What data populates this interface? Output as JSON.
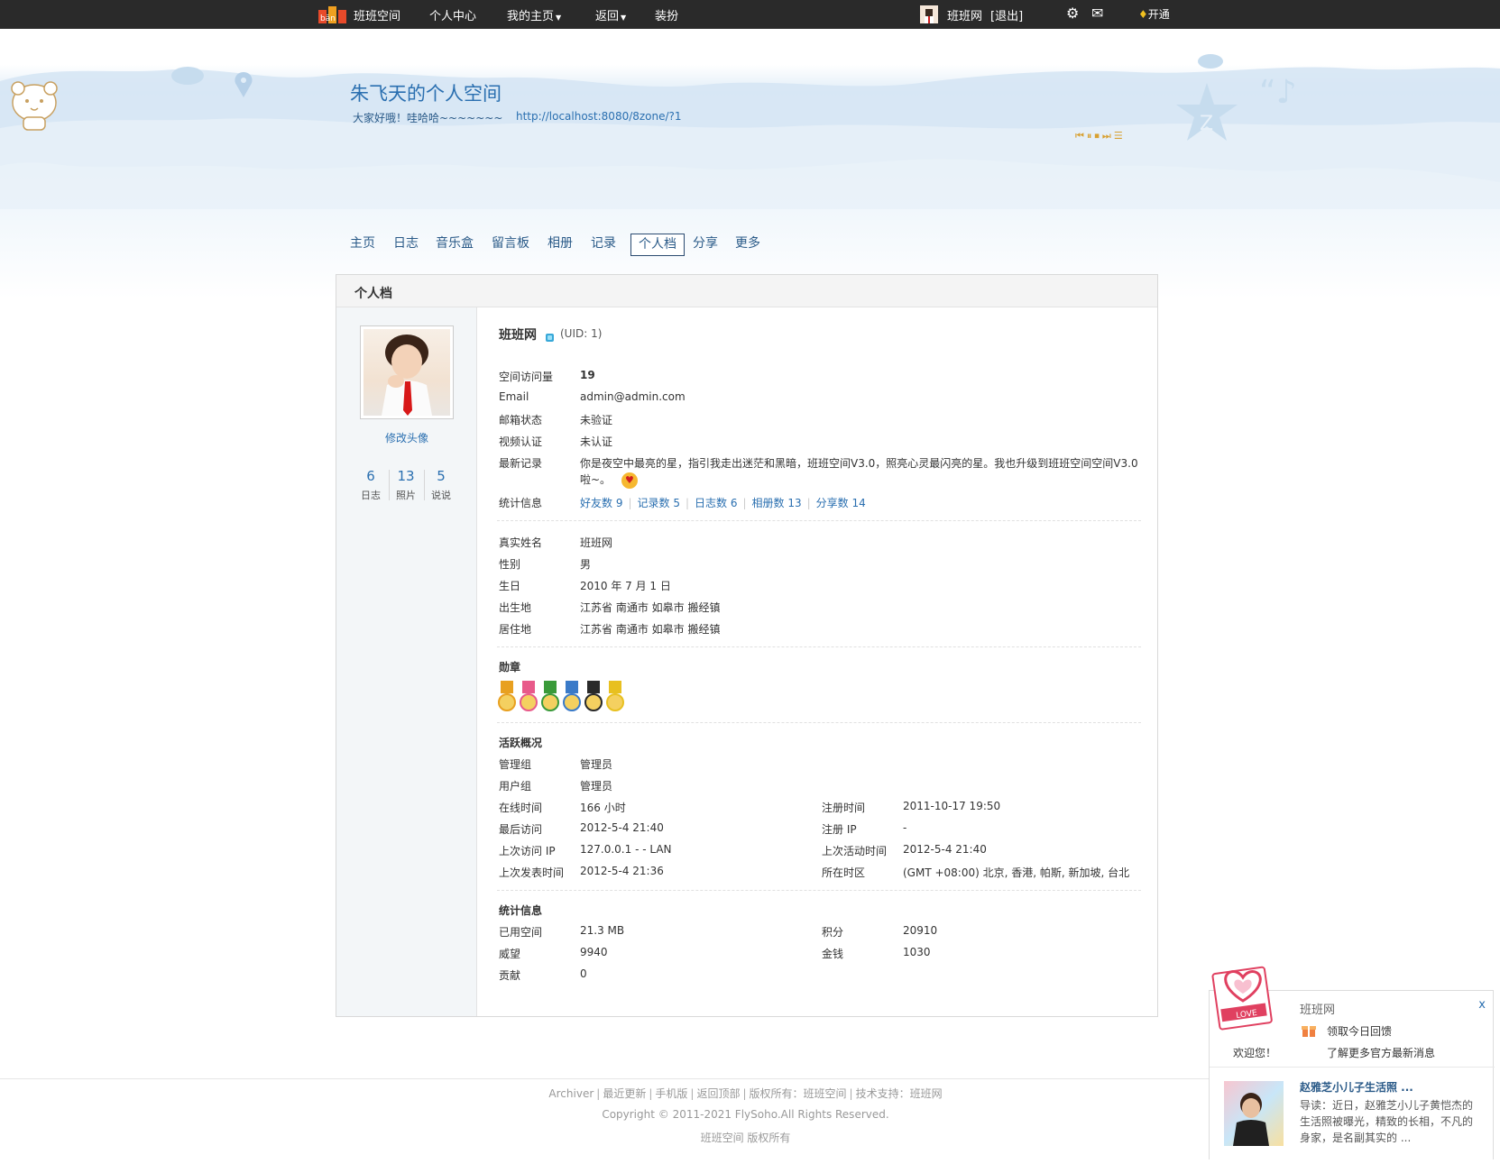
{
  "topbar": {
    "site_name": "班班空间",
    "personal_center": "个人中心",
    "my_home": "我的主页",
    "back": "返回",
    "decorate": "装扮",
    "username": "班班网",
    "logout": "[退出]",
    "open_vip": "开通"
  },
  "banner": {
    "title": "朱飞天的个人空间",
    "subtitle": "大家好哦！哇哈哈~~~~~~~",
    "url": "http://localhost:8080/8zone/?1"
  },
  "nav": {
    "tabs": [
      "主页",
      "日志",
      "音乐盒",
      "留言板",
      "相册",
      "记录",
      "个人档",
      "分享",
      "更多"
    ],
    "active": "个人档"
  },
  "panel": {
    "title": "个人档"
  },
  "sidebar": {
    "change_avatar": "修改头像",
    "stats": [
      {
        "value": "6",
        "label": "日志"
      },
      {
        "value": "13",
        "label": "照片"
      },
      {
        "value": "5",
        "label": "说说"
      }
    ]
  },
  "profile": {
    "name": "班班网",
    "uid": "(UID: 1)",
    "visits_label": "空间访问量",
    "visits_value": "19",
    "email_label": "Email",
    "email_value": "admin@admin.com",
    "email_status_label": "邮箱状态",
    "email_status_value": "未验证",
    "video_label": "视频认证",
    "video_value": "未认证",
    "latest_label": "最新记录",
    "latest_value": "你是夜空中最亮的星，指引我走出迷茫和黑暗，班班空间V3.0，照亮心灵最闪亮的星。我也升级到班班空间空间V3.0啦~。",
    "stats_label": "统计信息",
    "stat_links": [
      "好友数 9",
      "记录数 5",
      "日志数 6",
      "相册数 13",
      "分享数 14"
    ],
    "realname_label": "真实姓名",
    "realname_value": "班班网",
    "gender_label": "性别",
    "gender_value": "男",
    "birthday_label": "生日",
    "birthday_value": "2010 年 7 月 1 日",
    "birthplace_label": "出生地",
    "birthplace_value": "江苏省 南通市 如皋市 搬经镇",
    "residence_label": "居住地",
    "residence_value": "江苏省 南通市 如皋市 搬经镇"
  },
  "medals": {
    "title": "勋章",
    "colors": [
      "#e8a020",
      "#e85a8a",
      "#3a9a3a",
      "#3a7ac8",
      "#2a2a2a",
      "#e8c020"
    ]
  },
  "activity": {
    "title": "活跃概况",
    "admin_group_label": "管理组",
    "admin_group_value": "管理员",
    "user_group_label": "用户组",
    "user_group_value": "管理员",
    "online_label": "在线时间",
    "online_value": "166 小时",
    "register_label": "注册时间",
    "register_value": "2011-10-17 19:50",
    "last_visit_label": "最后访问",
    "last_visit_value": "2012-5-4 21:40",
    "register_ip_label": "注册 IP",
    "register_ip_value": "-",
    "last_ip_label": "上次访问 IP",
    "last_ip_value": "127.0.0.1 - - LAN",
    "last_active_label": "上次活动时间",
    "last_active_value": "2012-5-4 21:40",
    "last_post_label": "上次发表时间",
    "last_post_value": "2012-5-4 21:36",
    "timezone_label": "所在时区",
    "timezone_value": "(GMT +08:00) 北京, 香港, 帕斯, 新加坡, 台北"
  },
  "statistics": {
    "title": "统计信息",
    "used_space_label": "已用空间",
    "used_space_value": "21.3 MB",
    "points_label": "积分",
    "points_value": "20910",
    "prestige_label": "威望",
    "prestige_value": "9940",
    "money_label": "金钱",
    "money_value": "1030",
    "contrib_label": "贡献",
    "contrib_value": "0"
  },
  "footer": {
    "links": [
      "Archiver",
      "最近更新",
      "手机版",
      "返回顶部",
      "版权所有：班班空间",
      "技术支持：班班网"
    ],
    "copyright": "Copyright © 2011-2021 FlySoho.All Rights Reserved.",
    "rights": "班班空间 版权所有"
  },
  "notice": {
    "name": "班班网",
    "close": "x",
    "daily": "领取今日回馈",
    "welcome": "欢迎您！",
    "more": "了解更多官方最新消息",
    "article_title": "赵雅芝小儿子生活照 ...",
    "article_desc": "导读：近日，赵雅芝小儿子黄恺杰的生活照被曝光，精致的长相，不凡的身家，是名副其实的 ..."
  }
}
